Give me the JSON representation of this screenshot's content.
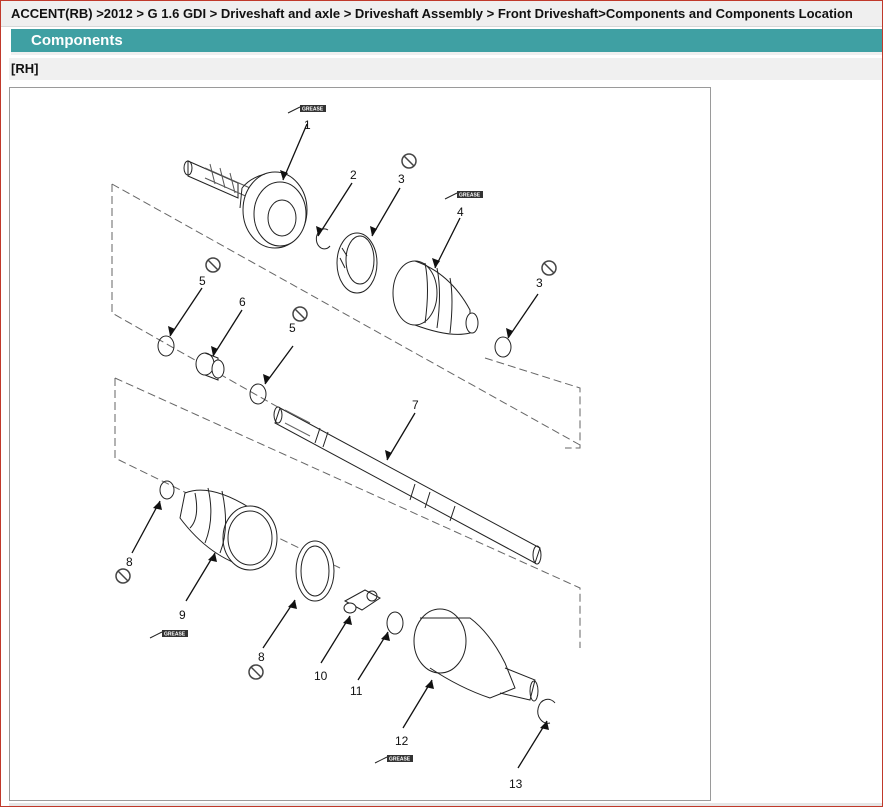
{
  "breadcrumb": {
    "part1": "ACCENT(RB) >2012 > G 1.6 GDI > Driveshaft and axle > Driveshaft Assembly > Front Driveshaft>Components and Components Location"
  },
  "section": {
    "title": "Components"
  },
  "subsection": {
    "label": "[RH]"
  },
  "diagram": {
    "grease_text": "GREASE",
    "labels": {
      "l1": "1",
      "l2": "2",
      "l3a": "3",
      "l3b": "3",
      "l4": "4",
      "l5a": "5",
      "l5b": "5",
      "l6": "6",
      "l7": "7",
      "l8a": "8",
      "l8b": "8",
      "l9": "9",
      "l10": "10",
      "l11": "11",
      "l12": "12",
      "l13": "13"
    }
  }
}
